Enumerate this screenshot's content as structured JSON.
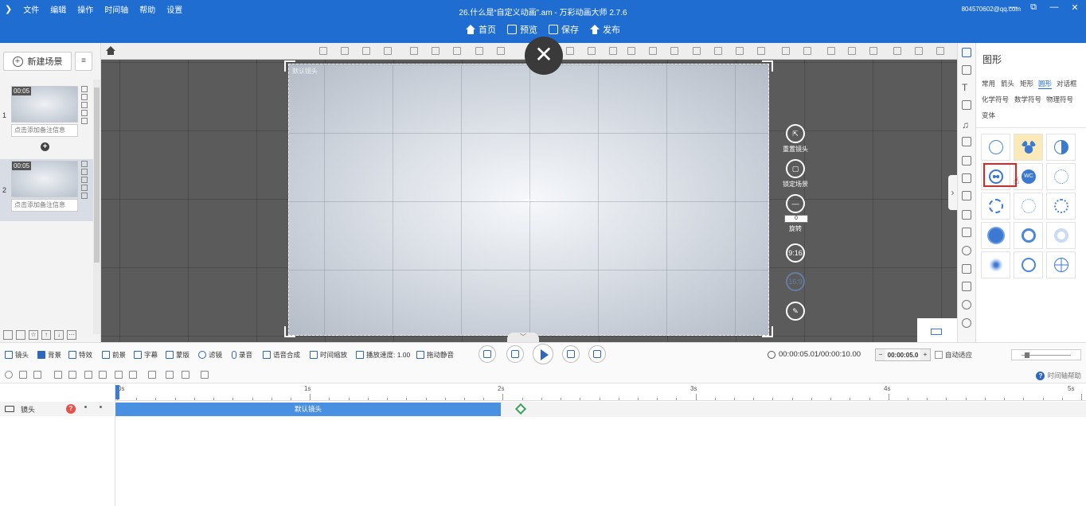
{
  "titlebar": {
    "logo": "❯",
    "menus": [
      "文件",
      "编辑",
      "操作",
      "时间轴",
      "帮助",
      "设置"
    ],
    "window_title": "26.什么是“自定义动画”.am - 万彩动画大师 2.7.6",
    "account": "804570602@qq.com",
    "controls": [
      "—",
      "⧉",
      "—",
      "✕"
    ]
  },
  "quickbar": {
    "home": "首页",
    "preview": "预览",
    "save": "保存",
    "publish": "发布"
  },
  "scene_panel": {
    "new_scene": "新建场景",
    "scenes": [
      {
        "number": "1",
        "time": "00:05",
        "note": "点击添加备注信息"
      },
      {
        "number": "2",
        "time": "00:05",
        "note": "点击添加备注信息"
      }
    ]
  },
  "canvas": {
    "stage_label": "默认镜头",
    "close_symbol": "✕",
    "controls": {
      "reset_camera": "重置镜头",
      "lock_scene": "锁定场景",
      "rotate": "旋转",
      "rotation_value": "0",
      "ratio_916": "9:16",
      "ratio_169": "16:9"
    }
  },
  "shape_panel": {
    "title": "图形",
    "categories_row1": [
      "常用",
      "箭头",
      "矩形",
      "圆形",
      "对话框"
    ],
    "categories_row2": [
      "化学符号",
      "数学符号",
      "物理符号"
    ],
    "categories_row3": [
      "变体"
    ],
    "active_category": "圆形",
    "tile_text_wc": "WC"
  },
  "timeline_toolbar": {
    "tools": [
      "镜头",
      "背景",
      "特效",
      "前景",
      "字幕",
      "蒙版",
      "滤镜",
      "录音",
      "语音合成",
      "时间缩放",
      "播放速度: 1.00",
      "拖动静音"
    ],
    "time": "00:00:05.01/00:00:10.00",
    "zoom_value": "00:00:05.0",
    "auto_fit": "自动适应",
    "help": "时间轴帮助"
  },
  "timeline": {
    "track_name": "镜头",
    "warn_symbol": "?",
    "camera_bar_label": "默认镜头",
    "ruler_labels": [
      "0s",
      "1s",
      "2s",
      "3s",
      "4s",
      "5s"
    ]
  }
}
